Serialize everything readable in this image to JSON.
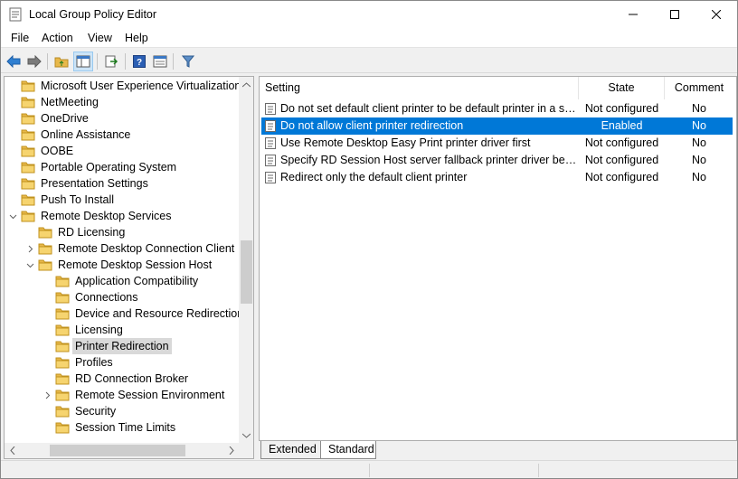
{
  "window": {
    "title": "Local Group Policy Editor"
  },
  "menu": {
    "file": "File",
    "action": "Action",
    "view": "View",
    "help": "Help"
  },
  "toolbar": {
    "icons": [
      "back-arrow-icon",
      "forward-arrow-icon",
      "up-folder-icon",
      "show-hide-tree-icon",
      "export-list-icon",
      "help-icon",
      "properties-icon",
      "filter-icon"
    ]
  },
  "tree": {
    "items": [
      {
        "label": "Microsoft User Experience Virtualization",
        "level": 0,
        "expander": "none"
      },
      {
        "label": "NetMeeting",
        "level": 0,
        "expander": "none"
      },
      {
        "label": "OneDrive",
        "level": 0,
        "expander": "none"
      },
      {
        "label": "Online Assistance",
        "level": 0,
        "expander": "none"
      },
      {
        "label": "OOBE",
        "level": 0,
        "expander": "none"
      },
      {
        "label": "Portable Operating System",
        "level": 0,
        "expander": "none"
      },
      {
        "label": "Presentation Settings",
        "level": 0,
        "expander": "none"
      },
      {
        "label": "Push To Install",
        "level": 0,
        "expander": "none"
      },
      {
        "label": "Remote Desktop Services",
        "level": 0,
        "expander": "expanded"
      },
      {
        "label": "RD Licensing",
        "level": 1,
        "expander": "none"
      },
      {
        "label": "Remote Desktop Connection Client",
        "level": 1,
        "expander": "collapsed"
      },
      {
        "label": "Remote Desktop Session Host",
        "level": 1,
        "expander": "expanded"
      },
      {
        "label": "Application Compatibility",
        "level": 2,
        "expander": "none"
      },
      {
        "label": "Connections",
        "level": 2,
        "expander": "none"
      },
      {
        "label": "Device and Resource Redirection",
        "level": 2,
        "expander": "none"
      },
      {
        "label": "Licensing",
        "level": 2,
        "expander": "none"
      },
      {
        "label": "Printer Redirection",
        "level": 2,
        "expander": "none",
        "selected": true
      },
      {
        "label": "Profiles",
        "level": 2,
        "expander": "none"
      },
      {
        "label": "RD Connection Broker",
        "level": 2,
        "expander": "none"
      },
      {
        "label": "Remote Session Environment",
        "level": 2,
        "expander": "collapsed"
      },
      {
        "label": "Security",
        "level": 2,
        "expander": "none"
      },
      {
        "label": "Session Time Limits",
        "level": 2,
        "expander": "none"
      }
    ]
  },
  "list": {
    "headers": {
      "setting": "Setting",
      "state": "State",
      "comment": "Comment"
    },
    "rows": [
      {
        "setting": "Do not set default client printer to be default printer in a session",
        "state": "Not configured",
        "comment": "No"
      },
      {
        "setting": "Do not allow client printer redirection",
        "state": "Enabled",
        "comment": "No",
        "selected": true
      },
      {
        "setting": "Use Remote Desktop Easy Print printer driver first",
        "state": "Not configured",
        "comment": "No"
      },
      {
        "setting": "Specify RD Session Host server fallback printer driver behavior",
        "state": "Not configured",
        "comment": "No"
      },
      {
        "setting": "Redirect only the default client printer",
        "state": "Not configured",
        "comment": "No"
      }
    ]
  },
  "tabs": {
    "extended": "Extended",
    "standard": "Standard"
  },
  "colors": {
    "selection": "#0078d7",
    "folder": "#e8b84a",
    "tree_selected": "#d9d9d9"
  }
}
